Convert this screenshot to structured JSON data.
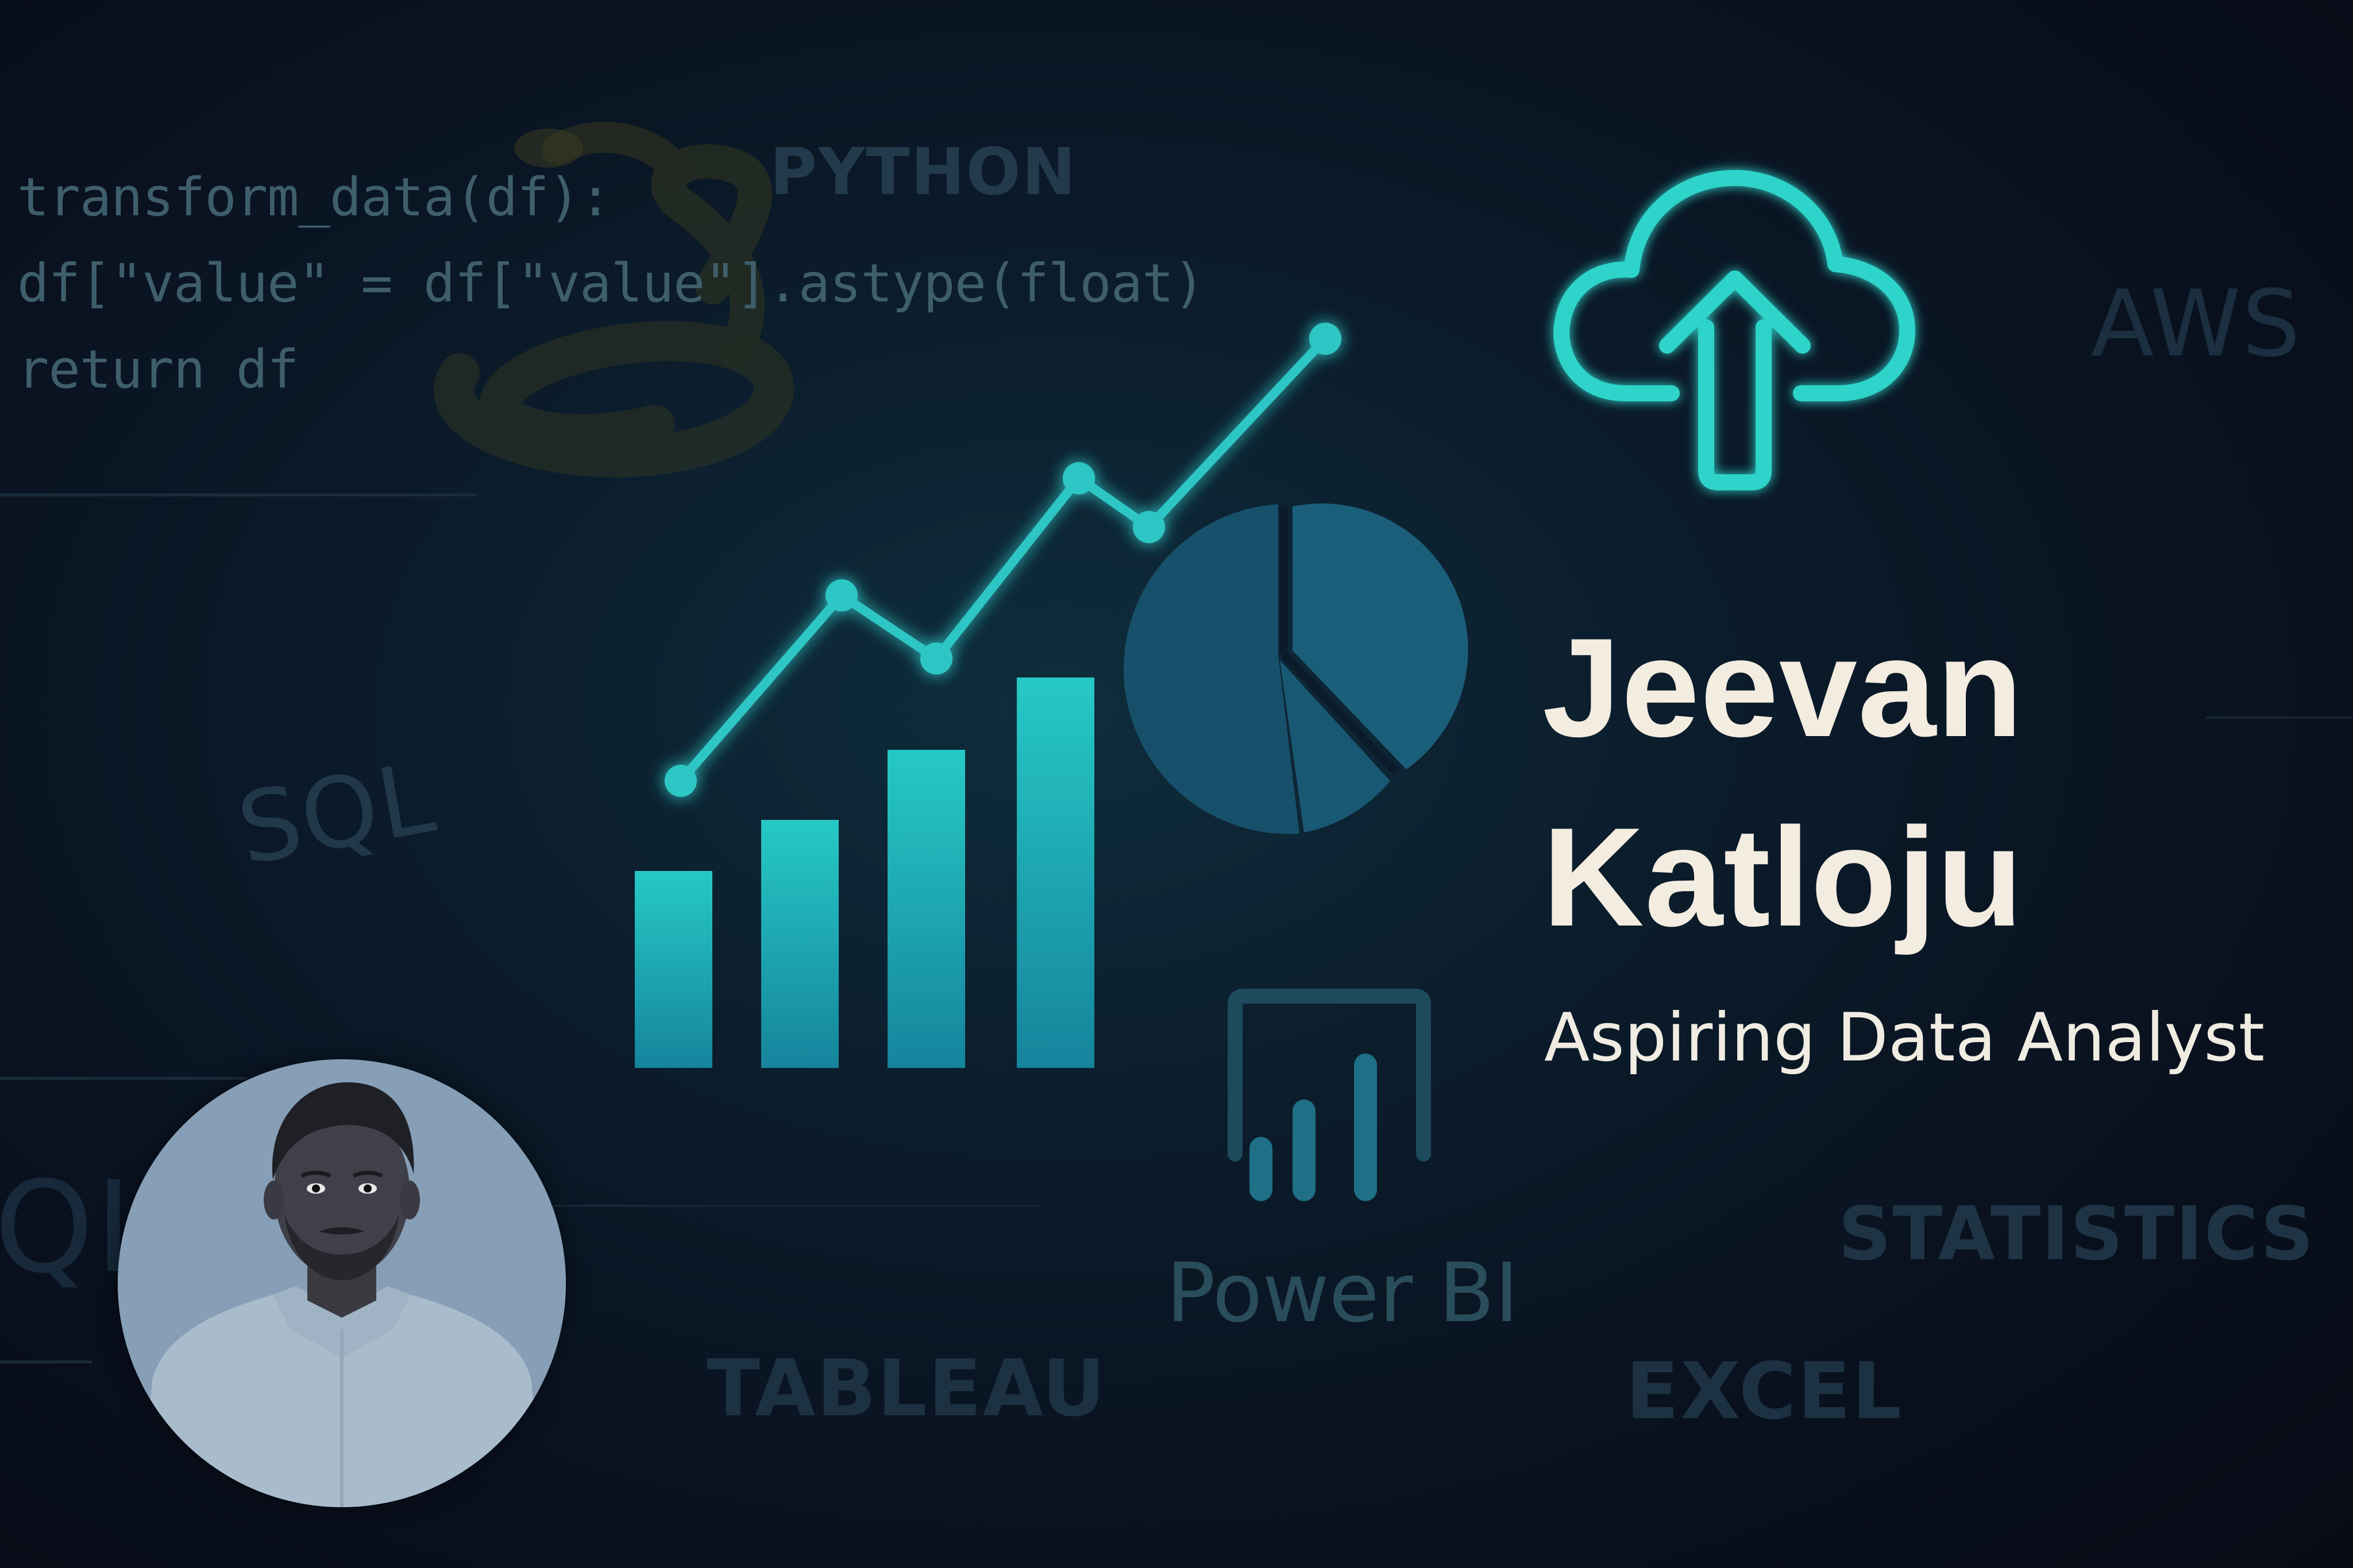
{
  "code_lines": [
    "transform_data(df):",
    "df[\"value\" = df[\"value\"].astype(float)",
    "return df"
  ],
  "keywords": {
    "python": "PYTHON",
    "aws": "AWS",
    "sql": "SQL",
    "sql_fragment": "QL",
    "tableau": "TABLEAU",
    "excel": "EXCEL",
    "statistics": "STATISTICS",
    "power_bi": "Power BI"
  },
  "profile": {
    "first_name": "Jeevan",
    "last_name": "Katloju",
    "role": "Aspiring Data Analyst"
  },
  "icons": [
    "snake-icon",
    "cloud-upload-icon",
    "line-chart-icon",
    "bar-chart-icon",
    "pie-chart-icon",
    "power-bi-icon"
  ],
  "colors": {
    "accent_teal": "#2ed3c9",
    "bar_teal": "#1fb3bc",
    "pie_teal": "#1d5f79",
    "title": "#f3ece0",
    "faint_text": "#3d5566"
  }
}
